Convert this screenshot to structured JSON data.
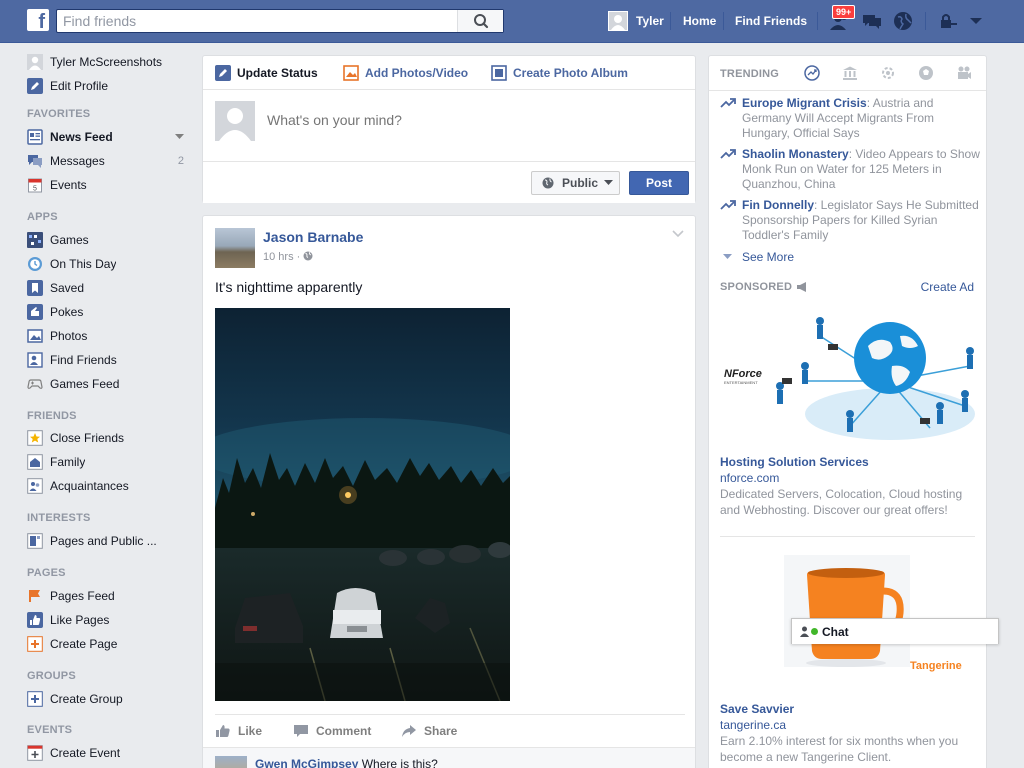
{
  "header": {
    "logo": "f",
    "search_placeholder": "Find friends",
    "user_name": "Tyler",
    "home_label": "Home",
    "find_friends_label": "Find Friends",
    "friend_requests_badge": "99+"
  },
  "leftnav": {
    "profile_name": "Tyler McScreenshots",
    "edit_profile": "Edit Profile",
    "favorites_heading": "FAVORITES",
    "news_feed": "News Feed",
    "messages": "Messages",
    "messages_count": "2",
    "events": "Events",
    "apps_heading": "APPS",
    "games": "Games",
    "on_this_day": "On This Day",
    "saved": "Saved",
    "pokes": "Pokes",
    "photos": "Photos",
    "find_friends": "Find Friends",
    "games_feed": "Games Feed",
    "friends_heading": "FRIENDS",
    "close_friends": "Close Friends",
    "family": "Family",
    "acquaintances": "Acquaintances",
    "interests_heading": "INTERESTS",
    "pages_and_public": "Pages and Public ...",
    "pages_heading": "PAGES",
    "pages_feed": "Pages Feed",
    "like_pages": "Like Pages",
    "create_page": "Create Page",
    "groups_heading": "GROUPS",
    "create_group": "Create Group",
    "events_heading": "EVENTS",
    "create_event": "Create Event"
  },
  "composer": {
    "tab_update_status": "Update Status",
    "tab_add_photos": "Add Photos/Video",
    "tab_create_album": "Create Photo Album",
    "placeholder": "What's on your mind?",
    "privacy_label": "Public",
    "post_button": "Post"
  },
  "post": {
    "author": "Jason Barnabe",
    "time": "10 hrs · ",
    "text": "It's nighttime apparently",
    "like_label": "Like",
    "comment_label": "Comment",
    "share_label": "Share",
    "comment_author": "Gwen McGimpsey",
    "comment_text": "Where is this?"
  },
  "trending": {
    "heading": "TRENDING",
    "items": [
      {
        "title": "Europe Migrant Crisis",
        "text": ": Austria and Germany Will Accept Migrants From Hungary, Official Says"
      },
      {
        "title": "Shaolin Monastery",
        "text": ": Video Appears to Show Monk Run on Water for 125 Meters in Quanzhou, China"
      },
      {
        "title": "Fin Donnelly",
        "text": ": Legislator Says He Submitted Sponsorship Papers for Killed Syrian Toddler's Family"
      }
    ],
    "see_more": "See More"
  },
  "sponsored": {
    "heading": "SPONSORED",
    "create_ad": "Create Ad",
    "ads": [
      {
        "logo_text": "NForce",
        "logo_subtext": "ENTERTAINMENT",
        "title": "Hosting Solution Services",
        "domain": "nforce.com",
        "description": "Dedicated Servers, Colocation, Cloud hosting and Webhosting. Discover our great offers!"
      },
      {
        "logo_text": "Tangerine",
        "title": "Save Savvier",
        "domain": "tangerine.ca",
        "description": "Earn 2.10% interest for six months when you become a new Tangerine Client."
      }
    ]
  },
  "chat": {
    "label": "Chat"
  },
  "colors": {
    "brand": "#4e69a2",
    "link": "#365899",
    "post_button": "#4267b2",
    "badge": "#fa3e3e"
  }
}
